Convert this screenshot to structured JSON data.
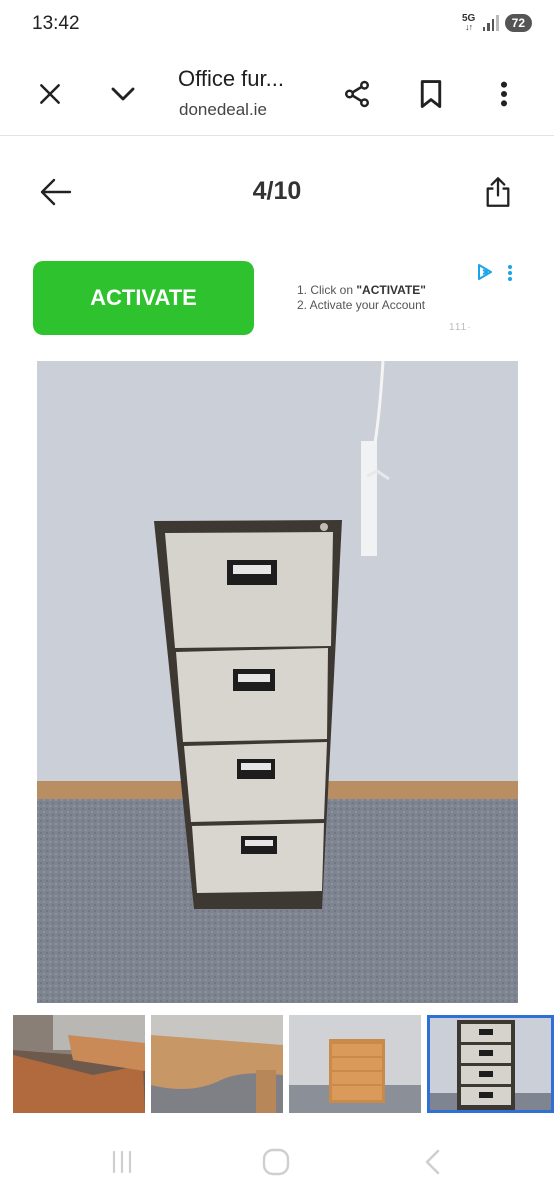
{
  "status_bar": {
    "time": "13:42",
    "network": "5G",
    "battery": "72"
  },
  "browser": {
    "title": "Office fur...",
    "domain": "donedeal.ie",
    "icons": [
      "close-icon",
      "chevron-down-icon",
      "share-icon",
      "bookmark-icon",
      "more-vert-icon"
    ]
  },
  "gallery": {
    "counter": "4/10",
    "icons": [
      "back-arrow-icon",
      "export-icon"
    ]
  },
  "ad": {
    "button_label": "ACTIVATE",
    "step1_prefix": "1. Click on ",
    "step1_emphasis": "\"ACTIVATE\"",
    "step2": "2. Activate your Account",
    "icons": [
      "ad-choices-icon",
      "ad-more-icon"
    ]
  },
  "main_image": {
    "subject": "grey four-drawer filing cabinet"
  },
  "thumbnails": [
    {
      "subject": "corner desk",
      "selected": false
    },
    {
      "subject": "wave desk",
      "selected": false
    },
    {
      "subject": "wooden drawer unit",
      "selected": false
    },
    {
      "subject": "filing cabinet",
      "selected": true
    }
  ],
  "colors": {
    "activate_green": "#2fc22f",
    "selected_outline": "#2f6fd6"
  },
  "nav_bar": {
    "icons": [
      "recents-icon",
      "home-icon",
      "back-icon"
    ]
  }
}
